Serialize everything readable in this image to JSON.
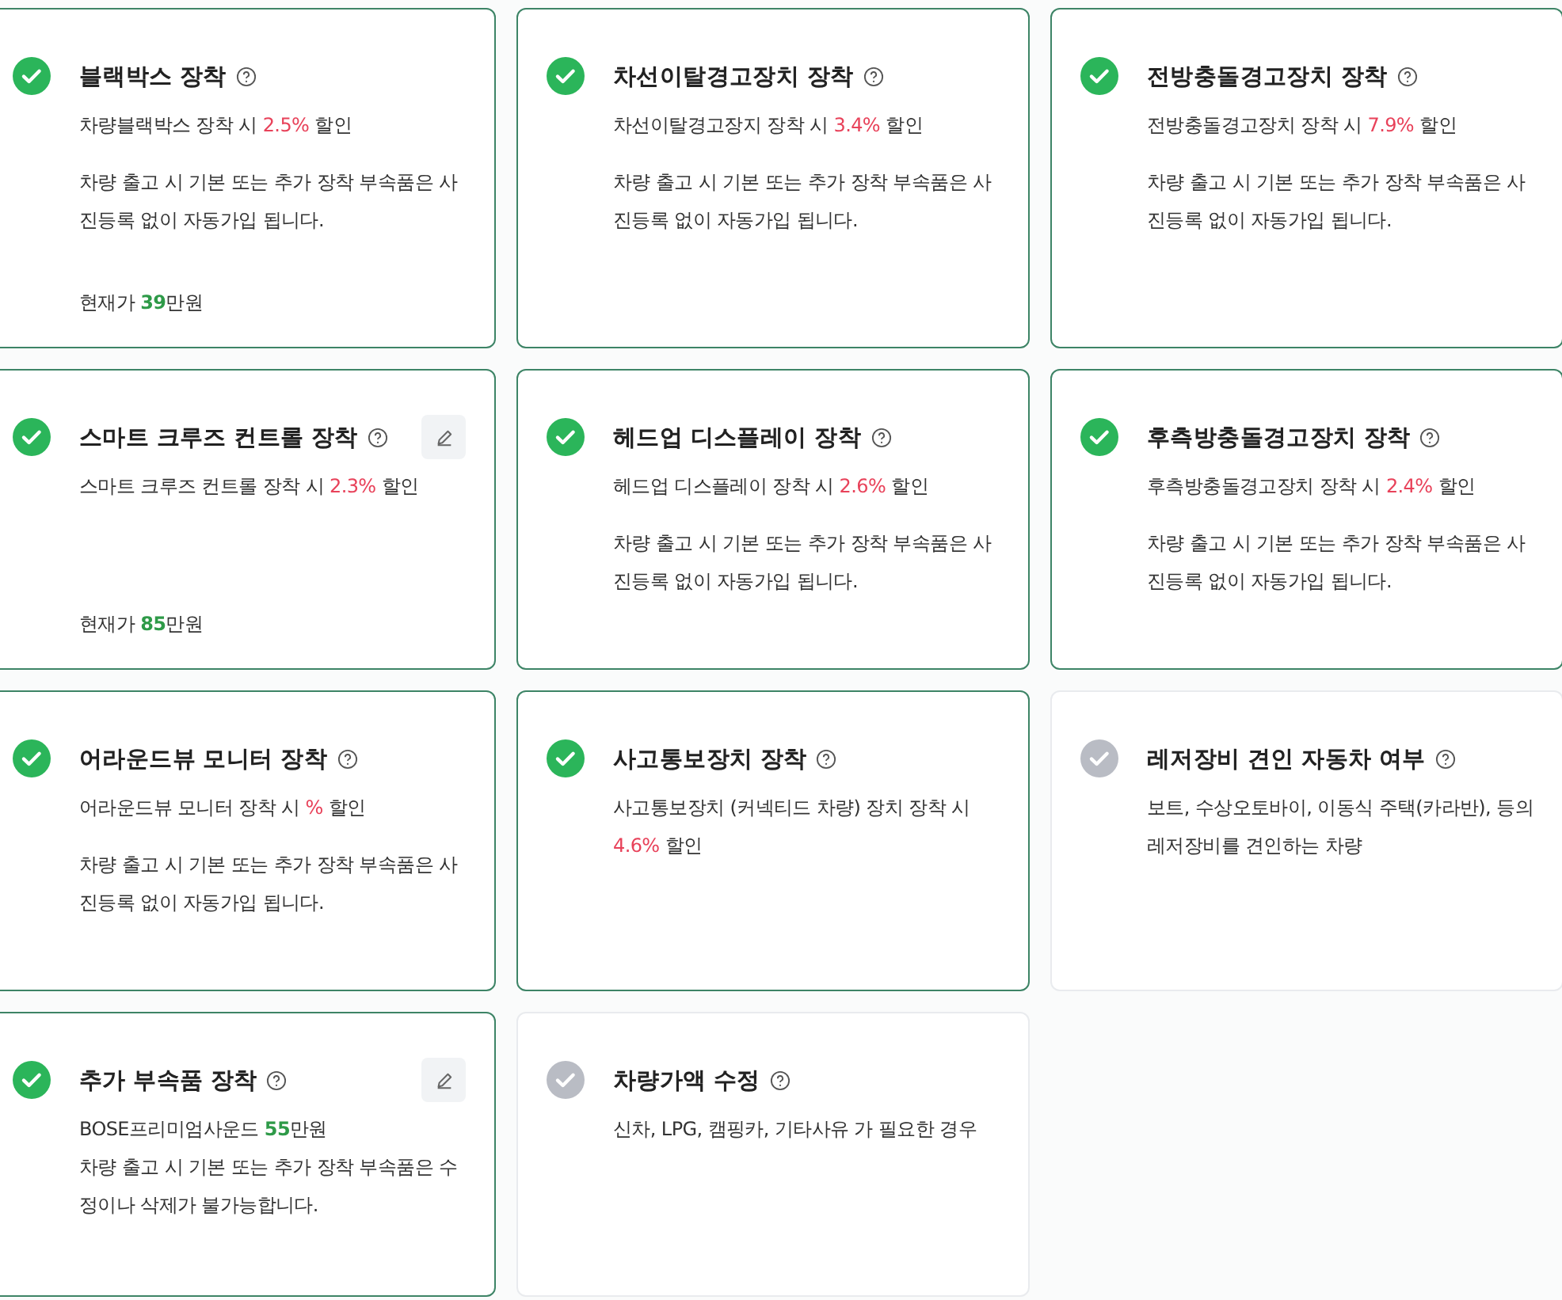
{
  "cards": [
    {
      "title": "블랙박스 장착",
      "checked": true,
      "editable": false,
      "lines": [
        {
          "kind": "discount",
          "parts": [
            "차량블랙박스 장착 시 ",
            "2.5%",
            " 할인"
          ]
        },
        {
          "kind": "note",
          "parts": [
            "차량 출고 시 기본 또는 추가 장착 부속품은 사진등록 없이 자동가입 됩니다."
          ]
        },
        {
          "kind": "price",
          "parts": [
            "현재가 ",
            "39",
            "만원"
          ]
        }
      ]
    },
    {
      "title": "차선이탈경고장치 장착",
      "checked": true,
      "editable": false,
      "lines": [
        {
          "kind": "discount",
          "parts": [
            "차선이탈경고장지 장착 시 ",
            "3.4%",
            " 할인"
          ]
        },
        {
          "kind": "note",
          "parts": [
            "차량 출고 시 기본 또는 추가 장착 부속품은 사진등록 없이 자동가입 됩니다."
          ]
        }
      ]
    },
    {
      "title": "전방충돌경고장치 장착",
      "checked": true,
      "editable": false,
      "lines": [
        {
          "kind": "discount",
          "parts": [
            "전방충돌경고장치 장착 시 ",
            "7.9%",
            " 할인"
          ]
        },
        {
          "kind": "note",
          "parts": [
            "차량 출고 시 기본 또는 추가 장착 부속품은 사진등록 없이 자동가입 됩니다."
          ]
        }
      ]
    },
    {
      "title": "스마트 크루즈 컨트롤 장착",
      "checked": true,
      "editable": true,
      "lines": [
        {
          "kind": "discount",
          "parts": [
            "스마트 크루즈 컨트롤 장착 시 ",
            "2.3%",
            " 할인"
          ]
        },
        {
          "kind": "price",
          "parts": [
            "현재가 ",
            "85",
            "만원"
          ]
        }
      ]
    },
    {
      "title": "헤드업 디스플레이 장착",
      "checked": true,
      "editable": false,
      "lines": [
        {
          "kind": "discount",
          "parts": [
            "헤드업 디스플레이 장착 시 ",
            "2.6%",
            " 할인"
          ]
        },
        {
          "kind": "note",
          "parts": [
            "차량 출고 시 기본 또는 추가 장착 부속품은 사진등록 없이 자동가입 됩니다."
          ]
        }
      ]
    },
    {
      "title": "후측방충돌경고장치 장착",
      "checked": true,
      "editable": false,
      "lines": [
        {
          "kind": "discount",
          "parts": [
            "후측방충돌경고장치 장착 시 ",
            "2.4%",
            " 할인"
          ]
        },
        {
          "kind": "note",
          "parts": [
            "차량 출고 시 기본 또는 추가 장착 부속품은 사진등록 없이 자동가입 됩니다."
          ]
        }
      ]
    },
    {
      "title": "어라운드뷰 모니터 장착",
      "checked": true,
      "editable": false,
      "lines": [
        {
          "kind": "discount",
          "parts": [
            "어라운드뷰 모니터 장착 시 ",
            "%",
            " 할인"
          ]
        },
        {
          "kind": "note",
          "parts": [
            "차량 출고 시 기본 또는 추가 장착 부속품은 사진등록 없이 자동가입 됩니다."
          ]
        }
      ]
    },
    {
      "title": "사고통보장치 장착",
      "checked": true,
      "editable": false,
      "lines": [
        {
          "kind": "discount",
          "parts": [
            "사고통보장치 (커넥티드 차량) 장치 장착 시 ",
            "4.6%",
            " 할인"
          ]
        }
      ]
    },
    {
      "title": "레저장비 견인 자동차 여부",
      "checked": false,
      "editable": false,
      "lines": [
        {
          "kind": "note",
          "parts": [
            "보트, 수상오토바이, 이동식 주택(카라반), 등의 레저장비를 견인하는 차량"
          ]
        }
      ]
    },
    {
      "title": "추가 부속품 장착",
      "checked": true,
      "editable": true,
      "lines": [
        {
          "kind": "option",
          "parts": [
            "BOSE프리미엄사운드 ",
            "55",
            "만원"
          ]
        },
        {
          "kind": "note",
          "parts": [
            "차량 출고 시 기본 또는 추가 장착 부속품은 수정이나 삭제가 불가능합니다."
          ]
        }
      ]
    },
    {
      "title": "차량가액 수정",
      "checked": false,
      "editable": false,
      "lines": [
        {
          "kind": "note",
          "parts": [
            "신차, LPG, 캠핑카, 기타사유 가 필요한 경우"
          ]
        }
      ]
    }
  ]
}
